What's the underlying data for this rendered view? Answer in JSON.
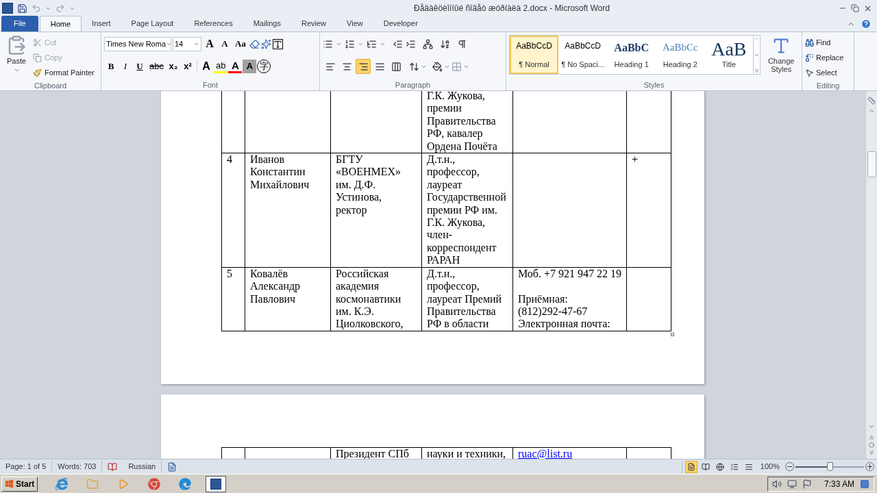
{
  "window": {
    "title": "Ðåäàêöèîííûé ñîâåò æóðíàëà 2.docx - Microsoft Word"
  },
  "tabs": [
    {
      "label": "File",
      "kind": "file",
      "selected": false
    },
    {
      "label": "Home",
      "kind": "tab",
      "selected": true
    },
    {
      "label": "Insert",
      "kind": "tab",
      "selected": false
    },
    {
      "label": "Page Layout",
      "kind": "tab",
      "selected": false
    },
    {
      "label": "References",
      "kind": "tab",
      "selected": false
    },
    {
      "label": "Mailings",
      "kind": "tab",
      "selected": false
    },
    {
      "label": "Review",
      "kind": "tab",
      "selected": false
    },
    {
      "label": "View",
      "kind": "tab",
      "selected": false
    },
    {
      "label": "Developer",
      "kind": "tab",
      "selected": false
    }
  ],
  "ribbon": {
    "clipboard": {
      "label": "Clipboard",
      "paste": "Paste",
      "items": [
        {
          "label": "Cut",
          "kind": "cut",
          "disabled": true
        },
        {
          "label": "Copy",
          "kind": "copy",
          "disabled": true
        },
        {
          "label": "Format Painter",
          "kind": "painter",
          "disabled": false
        }
      ]
    },
    "font": {
      "label": "Font",
      "font_name": "Times New Roma",
      "font_size": "14",
      "top_glyphs": [
        {
          "glyph": "A",
          "kind": "grow"
        },
        {
          "glyph": "A",
          "kind": "shrink"
        },
        {
          "glyph": "Aa",
          "kind": "case"
        }
      ],
      "format_glyphs": [
        {
          "glyph": "B",
          "kind": "bold"
        },
        {
          "glyph": "I",
          "kind": "italic"
        },
        {
          "glyph": "U",
          "kind": "underline"
        },
        {
          "glyph": "abc",
          "kind": "strike"
        },
        {
          "glyph": "x₂",
          "kind": "sub"
        },
        {
          "glyph": "x²",
          "kind": "sup"
        }
      ],
      "color_glyphs": [
        {
          "glyph": "A",
          "kind": "effects"
        },
        {
          "glyph": "ab",
          "kind": "highlight"
        },
        {
          "glyph": "A",
          "kind": "font-color"
        },
        {
          "glyph": "A",
          "kind": "shading"
        },
        {
          "glyph": "字",
          "kind": "enclose"
        }
      ]
    },
    "paragraph": {
      "label": "Paragraph",
      "alignments": [
        {
          "selected": false
        },
        {
          "selected": false
        },
        {
          "selected": true
        },
        {
          "selected": false
        },
        {
          "selected": false
        }
      ]
    },
    "styles": {
      "label": "Styles",
      "change_styles": "Change Styles",
      "items": [
        {
          "preview": "AaBbCcD",
          "name": "¶ Normal",
          "kind": "body",
          "selected": true
        },
        {
          "preview": "AaBbCcD",
          "name": "¶ No Spaci...",
          "kind": "body",
          "selected": false
        },
        {
          "preview": "AaBbC",
          "name": "Heading 1",
          "kind": "heading1",
          "selected": false
        },
        {
          "preview": "AaBbCc",
          "name": "Heading 2",
          "kind": "heading2",
          "selected": false
        },
        {
          "preview": "AaB",
          "name": "Title",
          "kind": "title",
          "selected": false
        }
      ]
    },
    "editing": {
      "label": "Editing",
      "items": [
        {
          "label": "Find",
          "kind": "find"
        },
        {
          "label": "Replace",
          "kind": "replace"
        },
        {
          "label": "Select",
          "kind": "select"
        }
      ]
    }
  },
  "document": {
    "pages": [
      {
        "rows": [
          {
            "cells": [
              {},
              {},
              {},
              {
                "text": "Г.К. Жукова,\nпремии\nПравительства\nРФ, кавалер\nОрдена Почёта"
              },
              {},
              {}
            ]
          },
          {
            "cells": [
              {
                "text": "4"
              },
              {
                "text": "Иванов\nКонстантин\nМихайлович"
              },
              {
                "text": "БГТУ\n«ВОЕНМЕХ»\nим. Д.Ф.\nУстинова,\nректор"
              },
              {
                "text": "Д.т.н.,\nпрофессор,\nлауреат\nГосударственной\nпремии РФ им.\nГ.К. Жукова,\nчлен-\nкорреспондент\nРАРАН"
              },
              {},
              {
                "text": "+"
              }
            ]
          },
          {
            "cells": [
              {
                "text": "5"
              },
              {
                "text": "Ковалёв\nАлександр\nПавлович"
              },
              {
                "text": "Российская\nакадемия\nкосмонавтики\nим. К.Э.\nЦиолковского,"
              },
              {
                "text": "Д.т.н.,\nпрофессор,\nлауреат Премий\nПравительства\nРФ в области"
              },
              {
                "text": "Моб. +7 921 947 22 19\n\nПриёмная:\n(812)292-47-67\nЭлектронная почта:"
              },
              {}
            ]
          }
        ]
      },
      {
        "rows": [
          {
            "cells": [
              {},
              {},
              {
                "text": "Президент СПб"
              },
              {
                "text": "науки и техники,"
              },
              {
                "text": "ruac@list.ru",
                "kind": "link"
              },
              {}
            ]
          }
        ]
      }
    ]
  },
  "status_bar": {
    "page": "Page: 1 of 5",
    "words": "Words: 703",
    "language": "Russian",
    "views": [
      {
        "selected": true
      },
      {
        "selected": false
      },
      {
        "selected": false
      },
      {
        "selected": false
      },
      {
        "selected": false
      }
    ],
    "zoom": "100%",
    "zoom_slider": {
      "level": 0.5
    }
  },
  "taskbar": {
    "start": "Start",
    "clock": "7:33 AM",
    "apps": [
      {
        "kind": "ie",
        "selected": false
      },
      {
        "kind": "folder",
        "selected": false
      },
      {
        "kind": "media",
        "selected": false
      },
      {
        "kind": "chrome",
        "selected": false
      },
      {
        "kind": "edge",
        "selected": false
      },
      {
        "kind": "word",
        "selected": true
      }
    ]
  }
}
